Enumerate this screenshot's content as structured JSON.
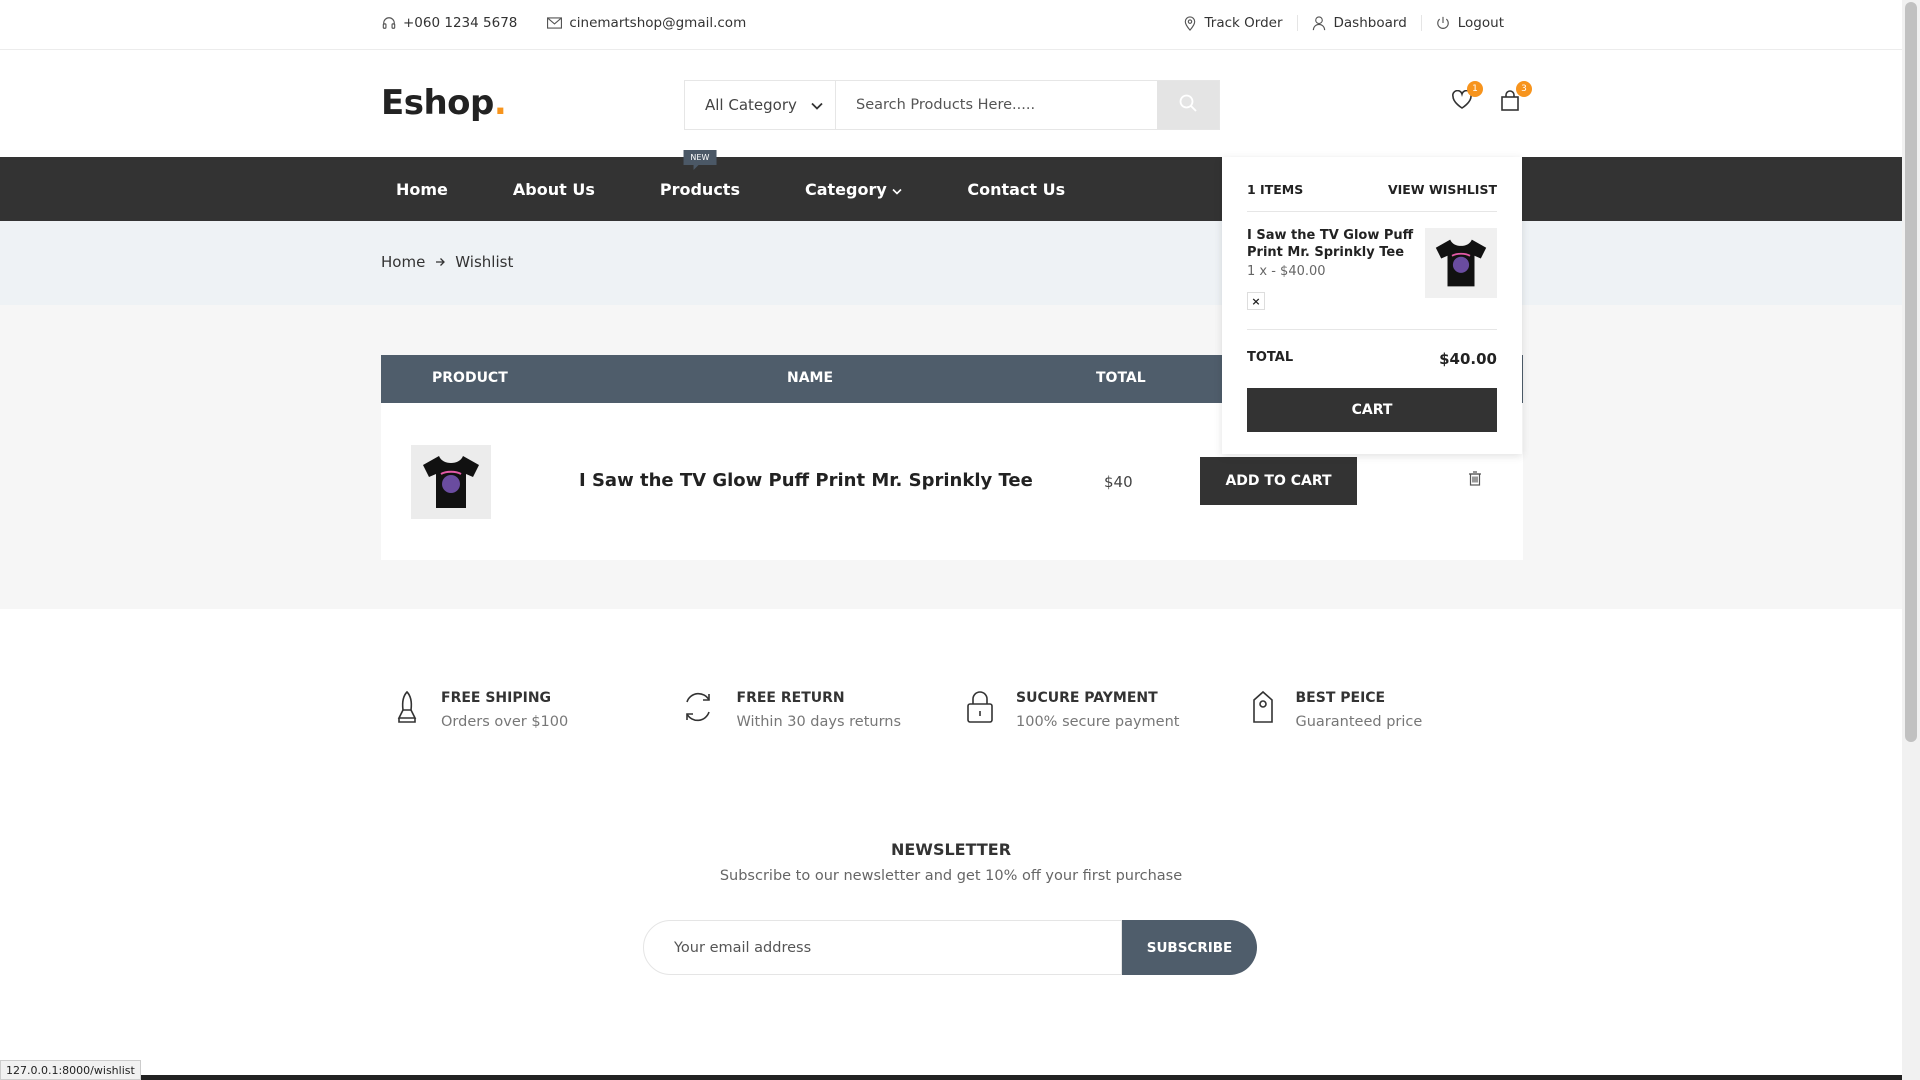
{
  "topbar": {
    "phone": "+060 1234 5678",
    "email": "cinemartshop@gmail.com",
    "track_order": "Track Order",
    "dashboard": "Dashboard",
    "logout": "Logout"
  },
  "header": {
    "logo_text": "Eshop",
    "logo_dot": ".",
    "category_select": "All Category",
    "search_placeholder": "Search Products Here.....",
    "wishlist_count": "1",
    "cart_count": "3"
  },
  "nav": {
    "items": [
      "Home",
      "About Us",
      "Products",
      "Category",
      "Contact Us"
    ],
    "new_tag": "NEW"
  },
  "breadcrumb": {
    "home": "Home",
    "current": "Wishlist"
  },
  "wishlist_table": {
    "headers": {
      "product": "PRODUCT",
      "name": "NAME",
      "total": "TOTAL"
    },
    "rows": [
      {
        "name": "I Saw the TV Glow Puff Print Mr. Sprinkly Tee",
        "total": "$40",
        "action": "ADD TO CART"
      }
    ]
  },
  "cart_dropdown": {
    "items_count": "1 ITEMS",
    "view_wishlist": "VIEW WISHLIST",
    "item_name": "I Saw the TV Glow Puff Print Mr. Sprinkly Tee",
    "item_qty": "1 x - $40.00",
    "remove": "×",
    "total_label": "TOTAL",
    "total_amount": "$40.00",
    "cart_button": "CART"
  },
  "services": [
    {
      "title": "FREE SHIPING",
      "subtitle": "Orders over $100",
      "icon": "rocket-icon"
    },
    {
      "title": "FREE RETURN",
      "subtitle": "Within 30 days returns",
      "icon": "refresh-icon"
    },
    {
      "title": "SUCURE PAYMENT",
      "subtitle": "100% secure payment",
      "icon": "lock-icon"
    },
    {
      "title": "BEST PEICE",
      "subtitle": "Guaranteed price",
      "icon": "tag-icon"
    }
  ],
  "newsletter": {
    "title": "NEWSLETTER",
    "subtitle": "Subscribe to our newsletter and get 10% off your first purchase",
    "placeholder": "Your email address",
    "button": "SUBSCRIBE"
  },
  "status_bar": "127.0.0.1:8000/wishlist",
  "colors": {
    "accent": "#f7941d",
    "dark": "#333333",
    "slate": "#4f5d6b"
  }
}
